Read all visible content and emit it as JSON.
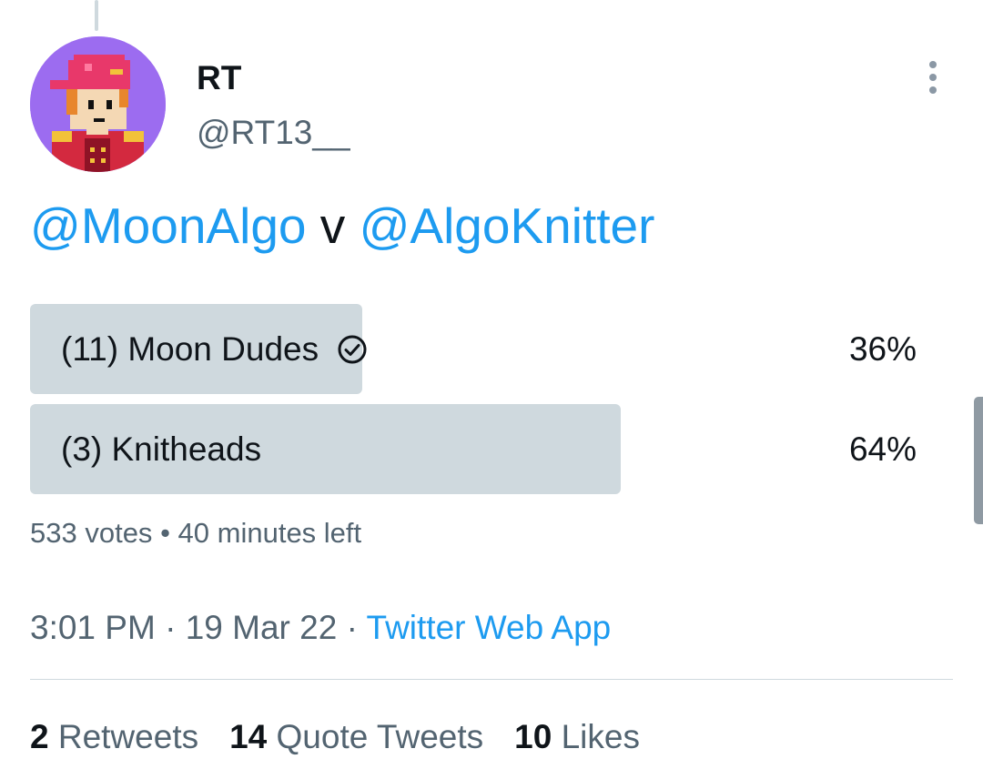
{
  "tweet": {
    "author": {
      "display_name": "RT",
      "handle": "@RT13__"
    },
    "text": {
      "mention_1": "@MoonAlgo",
      "separator": " v ",
      "mention_2": "@AlgoKnitter"
    },
    "poll": {
      "options": [
        {
          "label": "(11) Moon Dudes",
          "percent_text": "36%",
          "percent": 36,
          "selected_by_user": true
        },
        {
          "label": "(3) Knitheads",
          "percent_text": "64%",
          "percent": 64,
          "selected_by_user": false
        }
      ],
      "votes": "533 votes",
      "meta_separator": "•",
      "time_left": "40 minutes left"
    },
    "info": {
      "time": "3:01 PM",
      "date": "19 Mar 22",
      "separator": "·",
      "source": "Twitter Web App"
    },
    "stats": {
      "retweets_count": "2",
      "retweets_label": "Retweets",
      "quote_tweets_count": "14",
      "quote_tweets_label": "Quote Tweets",
      "likes_count": "10",
      "likes_label": "Likes"
    }
  },
  "icons": {
    "more": "more-vertical-icon",
    "poll_check": "check-circle-icon"
  },
  "colors": {
    "accent": "#1d9bf0",
    "text_primary": "#0f1419",
    "text_secondary": "#536471",
    "poll_bar": "#cfd9de",
    "avatar_bg": "#9c6cf0"
  }
}
